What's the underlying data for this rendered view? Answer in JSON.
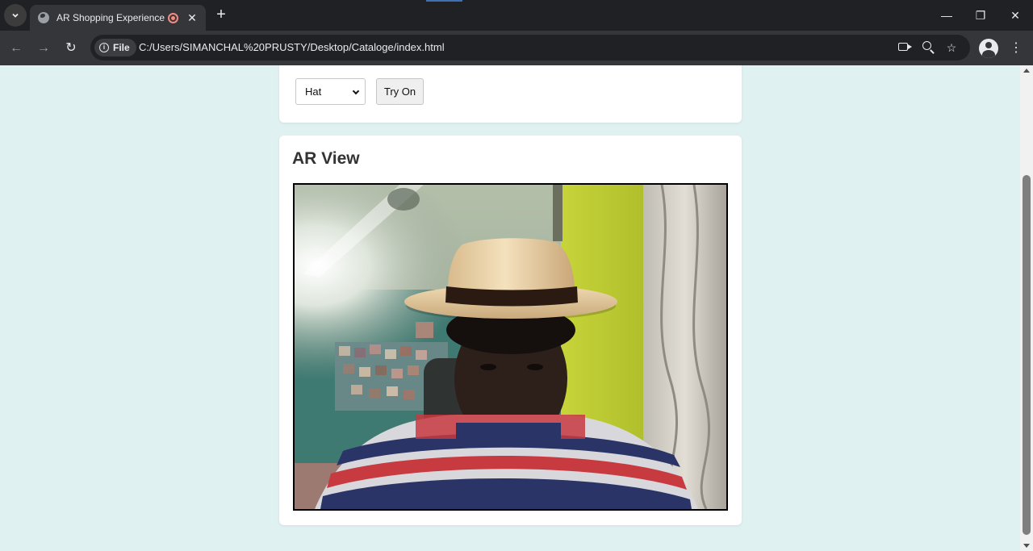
{
  "browser": {
    "tab_title": "AR Shopping Experience",
    "url_chip": "File",
    "url": "C:/Users/SIMANCHAL%20PRUSTY/Desktop/Cataloge/index.html",
    "icons": {
      "tab_search": "chevron-down-icon",
      "favicon": "globe-icon",
      "recording": "recording-icon",
      "close_tab": "close-icon",
      "new_tab": "plus-icon",
      "back": "back-arrow-icon",
      "forward": "forward-arrow-icon",
      "reload": "reload-icon",
      "site_info": "info-icon",
      "camera": "camera-icon",
      "zoom": "zoom-icon",
      "bookmark": "star-icon",
      "profile": "profile-icon",
      "menu": "kebab-menu-icon"
    }
  },
  "controls": {
    "selected_item": "Hat",
    "try_on_label": "Try On"
  },
  "ar_view": {
    "title": "AR View"
  },
  "colors": {
    "page_background": "#e0f1f1",
    "card_background": "#ffffff",
    "hat_band": "#2a1a12",
    "hat_straw": "#e8cfa3"
  }
}
